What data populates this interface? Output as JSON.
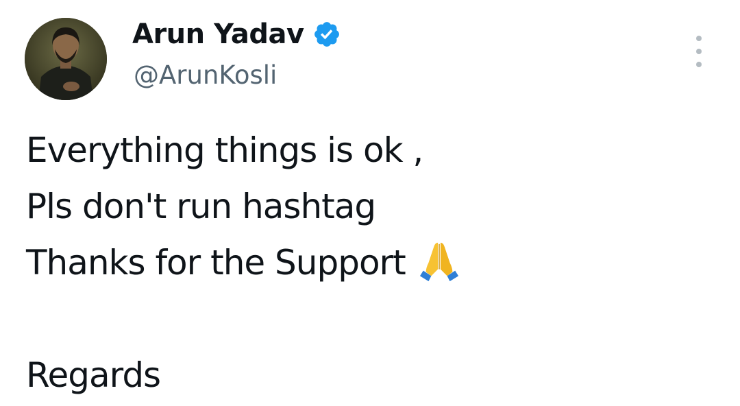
{
  "author": {
    "display_name": "Arun Yadav",
    "handle": "@ArunKosli",
    "verified": true
  },
  "tweet": {
    "lines": [
      "Everything things is ok ,",
      "Pls don't run hashtag",
      "Thanks for the Support",
      "",
      "Regards"
    ],
    "emoji": "folded-hands"
  },
  "icons": {
    "verified": "verified-badge-icon",
    "more": "more-options-icon",
    "emoji": "folded-hands-emoji"
  },
  "colors": {
    "text": "#0f1419",
    "handle": "#536471",
    "verified": "#1d9bf0",
    "more_dots": "#b4bcc2"
  }
}
